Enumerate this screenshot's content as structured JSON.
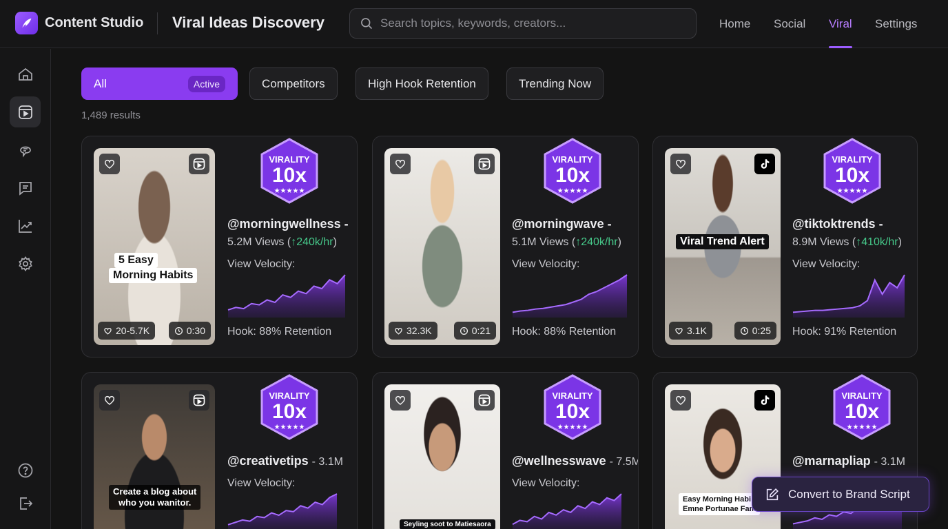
{
  "app": {
    "name": "Content Studio",
    "page_title": "Viral Ideas Discovery"
  },
  "search": {
    "placeholder": "Search topics, keywords, creators..."
  },
  "nav": [
    {
      "label": "Home",
      "active": false
    },
    {
      "label": "Social",
      "active": false
    },
    {
      "label": "Viral",
      "active": true
    },
    {
      "label": "Settings",
      "active": false
    }
  ],
  "sidebar": {
    "items": [
      {
        "icon": "home-icon"
      },
      {
        "icon": "video-library-icon",
        "active": true
      },
      {
        "icon": "ideas-icon"
      },
      {
        "icon": "messages-icon"
      },
      {
        "icon": "analytics-icon"
      },
      {
        "icon": "settings-icon"
      }
    ],
    "bottom": [
      {
        "icon": "help-icon"
      },
      {
        "icon": "logout-icon"
      }
    ]
  },
  "filters": [
    {
      "label": "All",
      "badge": "Active",
      "active": true
    },
    {
      "label": "Competitors"
    },
    {
      "label": "High Hook Retention"
    },
    {
      "label": "Trending Now"
    }
  ],
  "results": "1,489 results",
  "badge": {
    "top": "VIRALITY",
    "value": "10x"
  },
  "velocity_label": "View Velocity:",
  "cards": [
    {
      "platform": "reels",
      "handle": "@morningwellness -",
      "views": "5.2M Views (",
      "rate": "↑240k/hr",
      "close": ")",
      "likes": "20-5.7K",
      "duration": "0:30",
      "caption": [
        "5 Easy",
        "Morning Habits"
      ],
      "hook": "Hook: 88% Retention",
      "velocity": [
        10,
        14,
        12,
        20,
        18,
        26,
        22,
        34,
        30,
        40,
        36,
        48,
        44,
        58,
        52,
        66
      ]
    },
    {
      "platform": "reels",
      "handle": "@morningwave -",
      "views": "5.1M Views (",
      "rate": "↑240k/hr",
      "close": ")",
      "likes": "32.3K",
      "duration": "0:21",
      "caption": [],
      "hook": "Hook: 88% Retention",
      "velocity": [
        6,
        8,
        9,
        11,
        12,
        14,
        16,
        18,
        22,
        26,
        34,
        38,
        44,
        50,
        56,
        64
      ]
    },
    {
      "platform": "tiktok",
      "handle": "@tiktoktrends -",
      "views": "8.9M Views (",
      "rate": "↑410k/hr",
      "close": ")",
      "likes": "3.1K",
      "duration": "0:25",
      "caption": [
        "Viral Trend Alert"
      ],
      "hook": "Hook: 91% Retention",
      "velocity": [
        6,
        7,
        8,
        9,
        9,
        10,
        11,
        12,
        13,
        16,
        24,
        56,
        34,
        52,
        44,
        64
      ]
    },
    {
      "platform": "reels",
      "handle": "@creativetips",
      "views": "- 3.1M",
      "caption": [
        "Create a blog about",
        "who you wanitor."
      ],
      "velocity": [
        6,
        10,
        14,
        12,
        20,
        18,
        26,
        22,
        30,
        28,
        38,
        34,
        44,
        40,
        52,
        58
      ]
    },
    {
      "platform": "reels",
      "handle": "@wellnesswave",
      "views": "- 7.5M",
      "caption": [
        "Seyling soot to Matiesaora"
      ],
      "velocity": [
        6,
        12,
        10,
        18,
        14,
        24,
        20,
        28,
        24,
        34,
        30,
        40,
        36,
        46,
        42,
        52
      ]
    },
    {
      "platform": "tiktok",
      "handle": "@marnapliap",
      "views": "- 3.1M",
      "caption": [
        "Easy Morning Habi",
        "Emne Portunae Fam"
      ],
      "velocity": [
        6,
        8,
        10,
        14,
        12,
        18,
        16,
        22,
        20,
        28,
        26,
        34,
        30,
        40,
        38,
        46
      ]
    }
  ],
  "cta": {
    "label": "Convert to Brand Script"
  }
}
